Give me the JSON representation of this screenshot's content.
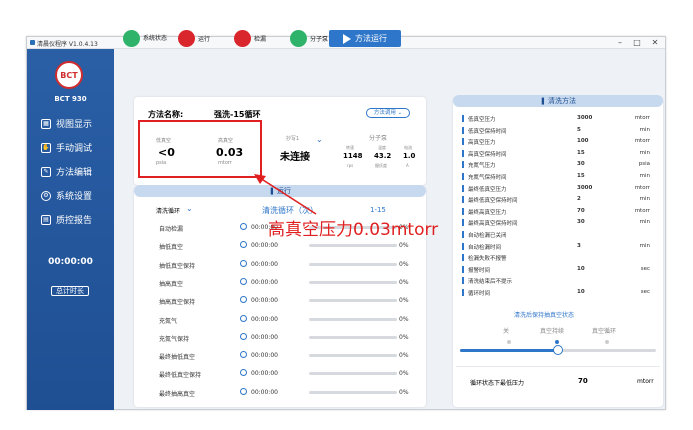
{
  "window": {
    "title": "清晨仪程序  V1.0.4.13",
    "minimize": "–",
    "maximize": "□",
    "close": "✕"
  },
  "sidebar": {
    "logo": "BCT",
    "brand": "BCT 930",
    "items": [
      {
        "label": "视图显示",
        "icon": "view-icon"
      },
      {
        "label": "手动调试",
        "icon": "manual-icon"
      },
      {
        "label": "方法编辑",
        "icon": "edit-icon"
      },
      {
        "label": "系统设置",
        "icon": "gear-icon"
      },
      {
        "label": "质控报告",
        "icon": "report-icon"
      }
    ],
    "clock": "00:00:00",
    "total_button": "总计时长"
  },
  "status_bar": {
    "items": [
      {
        "label": "系统状态",
        "color": "#2fb36a"
      },
      {
        "label": "运行",
        "color": "#d9262c"
      },
      {
        "label": "检漏",
        "color": "#d9262c"
      },
      {
        "label": "分子泵",
        "color": "#2fb36a"
      }
    ],
    "run_button": "方法运行"
  },
  "method": {
    "name_label": "方法名称:",
    "name_value": "强洗-15循环",
    "call_button": "方法调用 ⌄",
    "low_vac_label": "低真空",
    "low_vac_value": "<0",
    "low_vac_unit": "psia",
    "high_vac_label": "高真空",
    "high_vac_value": "0.03",
    "high_vac_unit": "mtorr",
    "connection_label": "抄写1",
    "connection_value": "未连接",
    "pump_label": "分子泵",
    "pump_cols": [
      {
        "value": "1148",
        "label": "转速",
        "unit": "rps"
      },
      {
        "value": "43.2",
        "label": "温度",
        "unit": "摄氏度"
      },
      {
        "value": "1.0",
        "label": "电流",
        "unit": "A"
      }
    ]
  },
  "run": {
    "header": "运行",
    "cycle_dropdown": "清洗循环",
    "cycle_label": "清洗循环（次）",
    "cycle_value": "1-15",
    "steps": [
      {
        "name": "自动检漏",
        "time": "00:00:00",
        "percent": "0%"
      },
      {
        "name": "抽低真空",
        "time": "00:00:00",
        "percent": "0%"
      },
      {
        "name": "抽低真空保持",
        "time": "00:00:00",
        "percent": "0%"
      },
      {
        "name": "抽高真空",
        "time": "00:00:00",
        "percent": "0%"
      },
      {
        "name": "抽高真空保持",
        "time": "00:00:00",
        "percent": "0%"
      },
      {
        "name": "充氮气",
        "time": "00:00:00",
        "percent": "0%"
      },
      {
        "name": "充氮气保持",
        "time": "00:00:00",
        "percent": "0%"
      },
      {
        "name": "最终抽低真空",
        "time": "00:00:00",
        "percent": "0%"
      },
      {
        "name": "最终低真空保持",
        "time": "00:00:00",
        "percent": "0%"
      },
      {
        "name": "最终抽高真空",
        "time": "00:00:00",
        "percent": "0%"
      }
    ]
  },
  "clean_method": {
    "header": "清洗方法",
    "params": [
      {
        "name": "低真空压力",
        "value": "3000",
        "unit": "mtorr"
      },
      {
        "name": "低真空保持时间",
        "value": "5",
        "unit": "min"
      },
      {
        "name": "高真空压力",
        "value": "100",
        "unit": "mtorr"
      },
      {
        "name": "高真空保持时间",
        "value": "15",
        "unit": "min"
      },
      {
        "name": "充氮气压力",
        "value": "30",
        "unit": "psia"
      },
      {
        "name": "充氮气保持时间",
        "value": "15",
        "unit": "min"
      },
      {
        "name": "最终低真空压力",
        "value": "3000",
        "unit": "mtorr"
      },
      {
        "name": "最终低真空保持时间",
        "value": "2",
        "unit": "min"
      },
      {
        "name": "最终高真空压力",
        "value": "70",
        "unit": "mtorr"
      },
      {
        "name": "最终高真空保持时间",
        "value": "30",
        "unit": "min"
      },
      {
        "name": "自动检漏已关闭",
        "value": "",
        "unit": ""
      },
      {
        "name": "自动检漏时间",
        "value": "3",
        "unit": "min"
      },
      {
        "name": "检漏失败不报警",
        "value": "",
        "unit": ""
      },
      {
        "name": "报警时间",
        "value": "10",
        "unit": "sec"
      },
      {
        "name": "清洗结束后不提示",
        "value": "",
        "unit": ""
      },
      {
        "name": "循环时间",
        "value": "10",
        "unit": "sec"
      }
    ],
    "post_state_title": "清洗后保持抽真空状态",
    "post_state_options": [
      "关",
      "真空持续",
      "真空循环"
    ],
    "post_state_selected": 1,
    "bottom_label": "循环状态下最低压力",
    "bottom_value": "70",
    "bottom_unit": "mtorr"
  },
  "annotation": {
    "text": "高真空压力0.03mtorr",
    "color": "#e02020"
  }
}
